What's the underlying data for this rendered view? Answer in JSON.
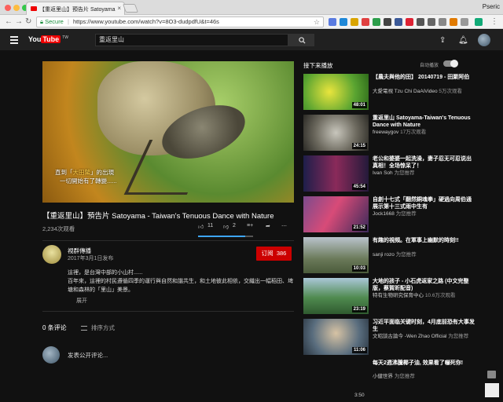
{
  "browser": {
    "tab_title": "【重返里山】預告片 Satoyama",
    "tab_close": "×",
    "profile": "Pseric",
    "secure_label": "Secure",
    "url": "https://www.youtube.com/watch?v=8O3-dudpdfU&t=46s"
  },
  "header": {
    "logo_text": "You",
    "logo_tube": "Tube",
    "logo_region": "TW",
    "search_value": "重返里山"
  },
  "video": {
    "subtitle_line1_pre": "直到「",
    "subtitle_line1_q": "大田鱉",
    "subtitle_line1_post": "」的出現",
    "subtitle_line2": "一切開始有了轉變......",
    "title": "【重返里山】預告片 Satoyama - Taiwan's Tenuous Dance with Nature",
    "views": "2,234次观看",
    "likes": "11",
    "dislikes": "2",
    "like_ratio": 0.85,
    "current_time": "3:50"
  },
  "channel": {
    "name": "視群傳播",
    "date": "2017年3月1日发布",
    "subscribe_label": "订阅",
    "subscriber_count": "386"
  },
  "description": {
    "line1": "這裡，是台灣中部的小山村......",
    "line2": "百年來，這裡的村民遵循四季的運行與自然和諧共生，和土地彼此相依，交織出一幅稻田、埤塘和森林的「里山」美景。",
    "more_label": "展开"
  },
  "comments": {
    "count_label": "0 条评论",
    "sort_label": "排序方式",
    "add_placeholder": "发表公开评论..."
  },
  "sidebar": {
    "upnext_label": "接下来播放",
    "autoplay_label": "自动播放",
    "autoplay_on": true,
    "items": [
      {
        "title": "【農夫與他的田】 20140719 - 田聚阿伯",
        "channel": "大愛電視 Tzu Chi DaAiVideo",
        "meta": "5万次观看",
        "duration": "48:01"
      },
      {
        "title": "重返里山 Satoyama-Taiwan's Tenuous Dance with Nature",
        "channel": "freewaygov",
        "meta": "17万次观看",
        "duration": "24:15"
      },
      {
        "title": "老公和婆婆一起洗澡，妻子忍无可忍说出真相！全场惊呆了！",
        "channel": "Ivan Soh",
        "meta": "为您推荐",
        "duration": "45:54"
      },
      {
        "title": "自創十七式「翻然銅魂拳」硬過向周伯通展示第十三式雨中生有",
        "channel": "Jock1668",
        "meta": "为您推荐",
        "duration": "21:52"
      },
      {
        "title": "有趣的視頻。在軍事上幽默的時刻!!",
        "channel": "sanji rozo",
        "meta": "为您推荐",
        "duration": "10:03"
      },
      {
        "title": "大地的孩子 - 小石虎返家之路 (中文完整版，蔡賀昕配音)",
        "channel": "特有生物研究保育中心",
        "meta": "10.6万次观看",
        "duration": "23:19"
      },
      {
        "title": "习近平面临关键时刻，4月底前恐有大事发生",
        "channel": "文昭談古論今 -Wen Zhao Official",
        "meta": "为您推荐",
        "duration": "11:06"
      },
      {
        "title": "每天2週沸騰椰子油, 效果看了嚇死你!",
        "channel": "小健世界",
        "meta": "为您推荐",
        "duration": ""
      }
    ]
  }
}
